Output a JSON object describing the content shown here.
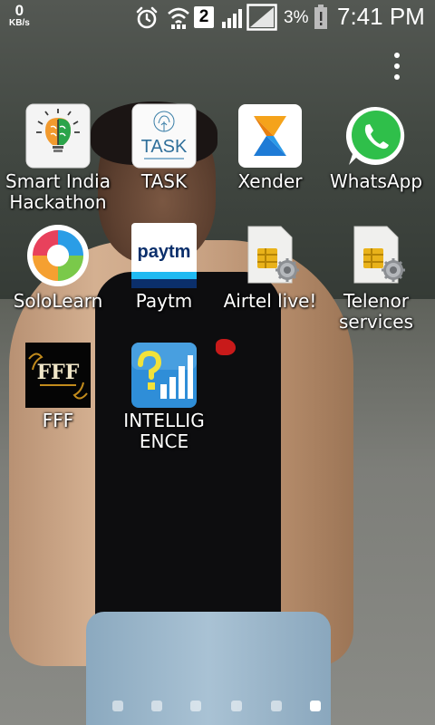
{
  "status_bar": {
    "net_speed_value": "0",
    "net_speed_unit": "KB/s",
    "sim_slot": "2",
    "battery_percent": "3%",
    "time": "7:41 PM"
  },
  "apps": [
    {
      "label_lines": [
        "Smart India",
        "Hackathon"
      ],
      "icon": "smart-india-hackathon-icon"
    },
    {
      "label_lines": [
        "TASK"
      ],
      "icon": "task-icon",
      "icon_text": "TASK"
    },
    {
      "label_lines": [
        "Xender"
      ],
      "icon": "xender-icon"
    },
    {
      "label_lines": [
        "WhatsApp"
      ],
      "icon": "whatsapp-icon"
    },
    {
      "label_lines": [
        "SoloLearn"
      ],
      "icon": "sololearn-icon"
    },
    {
      "label_lines": [
        "Paytm"
      ],
      "icon": "paytm-icon",
      "icon_text": "paytm"
    },
    {
      "label_lines": [
        "Airtel live!"
      ],
      "icon": "sim-toolkit-icon"
    },
    {
      "label_lines": [
        "Telenor",
        "services"
      ],
      "icon": "sim-toolkit-icon"
    },
    {
      "label_lines": [
        "FFF"
      ],
      "icon": "fff-icon",
      "icon_text": "FFF"
    },
    {
      "label_lines": [
        "INTELLIG",
        "ENCE"
      ],
      "icon": "intelligence-icon"
    }
  ],
  "page_indicator": {
    "count": 6,
    "active_index": 5
  },
  "colors": {
    "whatsapp_green": "#2fbf4a",
    "paytm_blue": "#0b2f6b",
    "paytm_light_blue": "#20baf2",
    "xender_orange": "#f5a31b",
    "xender_blue": "#1e7bd6",
    "intelligence_blue": "#2f8ed8"
  }
}
